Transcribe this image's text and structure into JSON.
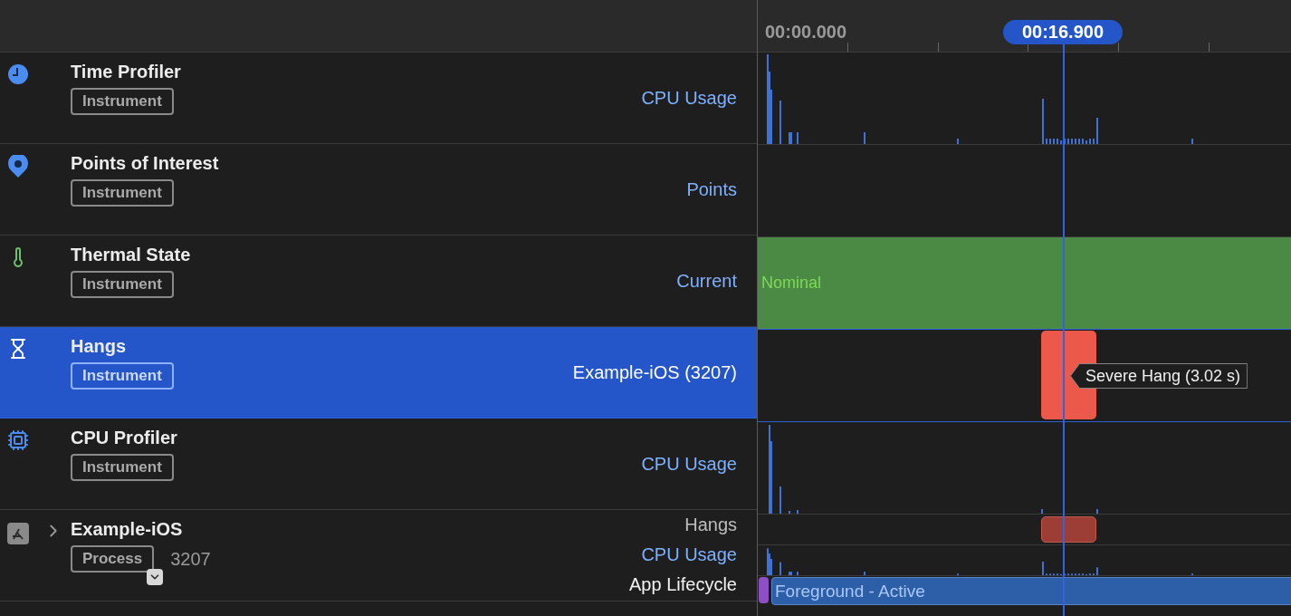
{
  "ruler": {
    "start_time": "00:00.000",
    "playhead_time": "00:16.900"
  },
  "tracks": [
    {
      "kind": "clock",
      "title": "Time Profiler",
      "tag": "Instrument",
      "detail": "CPU Usage",
      "selected": false,
      "lane": {
        "kind": "cpu"
      }
    },
    {
      "kind": "pin",
      "title": "Points of Interest",
      "tag": "Instrument",
      "detail": "Points",
      "selected": false,
      "lane": {
        "kind": "empty"
      }
    },
    {
      "kind": "thermometer",
      "title": "Thermal State",
      "tag": "Instrument",
      "detail": "Current",
      "selected": false,
      "lane": {
        "kind": "state",
        "label": "Nominal"
      }
    },
    {
      "kind": "hourglass",
      "title": "Hangs",
      "tag": "Instrument",
      "detail": "Example-iOS (3207)",
      "selected": true,
      "lane": {
        "kind": "hang",
        "label": "Severe Hang (3.02 s)"
      }
    },
    {
      "kind": "chip",
      "title": "CPU Profiler",
      "tag": "Instrument",
      "detail": "CPU Usage",
      "selected": false,
      "lane": {
        "kind": "cpu2"
      }
    }
  ],
  "process": {
    "title": "Example-iOS",
    "tag": "Process",
    "pid": "3207",
    "expanded": false,
    "lanes": [
      {
        "kind": "hang",
        "label": "Hangs"
      },
      {
        "kind": "cpu",
        "label": "CPU Usage"
      },
      {
        "kind": "lifecycle",
        "label": "App Lifecycle",
        "segments": [
          {
            "kind": "launch"
          },
          {
            "kind": "foreground",
            "label": "Foreground - Active"
          }
        ]
      }
    ]
  }
}
